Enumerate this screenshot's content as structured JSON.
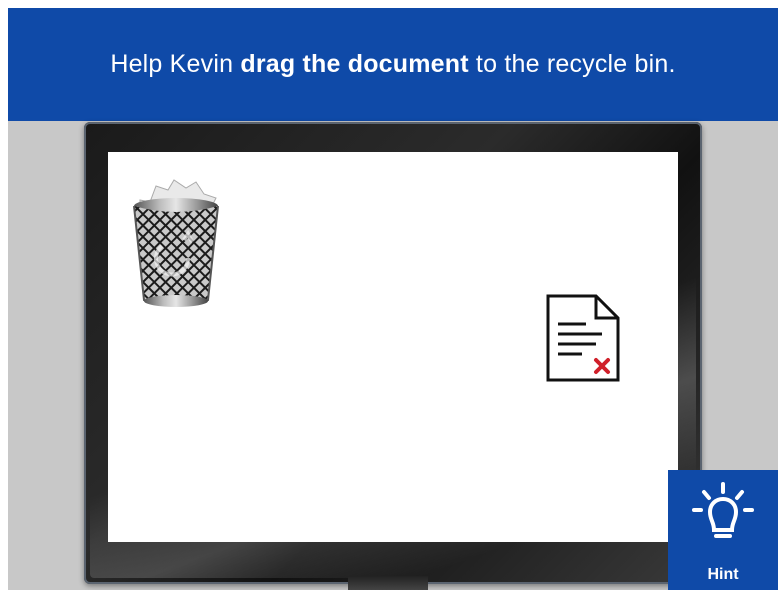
{
  "instruction": {
    "prefix": "Help Kevin ",
    "bold": "drag the document",
    "suffix": " to the recycle bin."
  },
  "hint": {
    "label": "Hint"
  },
  "icons": {
    "recycle_bin": "recycle-bin-icon",
    "document": "document-delete-icon",
    "hint": "lightbulb-icon"
  },
  "colors": {
    "banner": "#0f4aa8",
    "background": "#c8c8c8",
    "screen": "#ffffff",
    "delete_mark": "#d0202a"
  }
}
